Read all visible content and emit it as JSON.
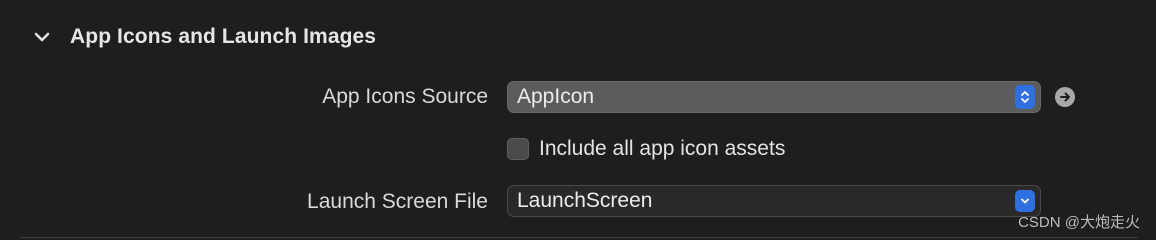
{
  "section": {
    "title": "App Icons and Launch Images",
    "expanded": true,
    "disclosure_icon": "chevron-down-icon"
  },
  "app_icons_source": {
    "label": "App Icons Source",
    "value": "AppIcon",
    "control_icon": "up-down-stepper-icon",
    "navigate_icon": "arrow-right-circle-icon"
  },
  "include_assets": {
    "label": "Include all app icon assets",
    "checked": false
  },
  "launch_screen": {
    "label": "Launch Screen File",
    "value": "LaunchScreen",
    "control_icon": "chevron-down-icon"
  },
  "watermark": "CSDN @大炮走火",
  "colors": {
    "background": "#1f1e1e",
    "accent": "#2f6fe0",
    "popup_filled": "#5c5c5c"
  }
}
